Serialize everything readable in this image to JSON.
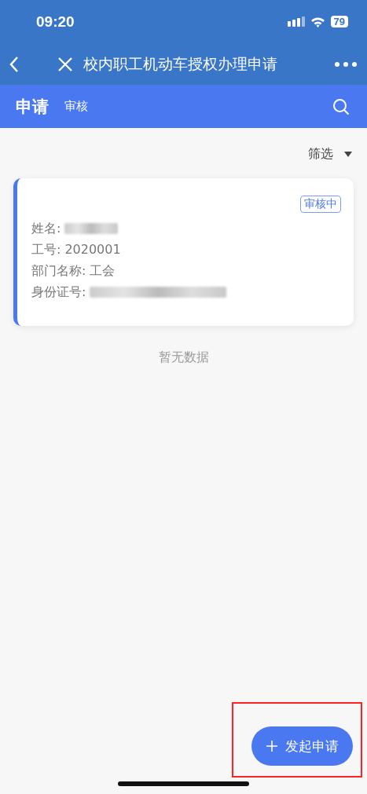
{
  "status_bar": {
    "time": "09:20",
    "battery": "79"
  },
  "nav_bar": {
    "title": "校内职工机动车授权办理申请"
  },
  "tabs": [
    {
      "label": "申请",
      "selected": true
    },
    {
      "label": "审核",
      "selected": false
    }
  ],
  "filter": {
    "label": "筛选"
  },
  "records": [
    {
      "status": "审核中",
      "fields": [
        {
          "label": "姓名:",
          "kind": "redacted"
        },
        {
          "label": "工号:",
          "kind": "text",
          "value": "2020001"
        },
        {
          "label": "部门名称:",
          "kind": "text",
          "value": "工会"
        },
        {
          "label": "身份证号:",
          "kind": "redacted"
        }
      ]
    }
  ],
  "empty_message": "暂无数据",
  "fab": {
    "label": "发起申请"
  }
}
